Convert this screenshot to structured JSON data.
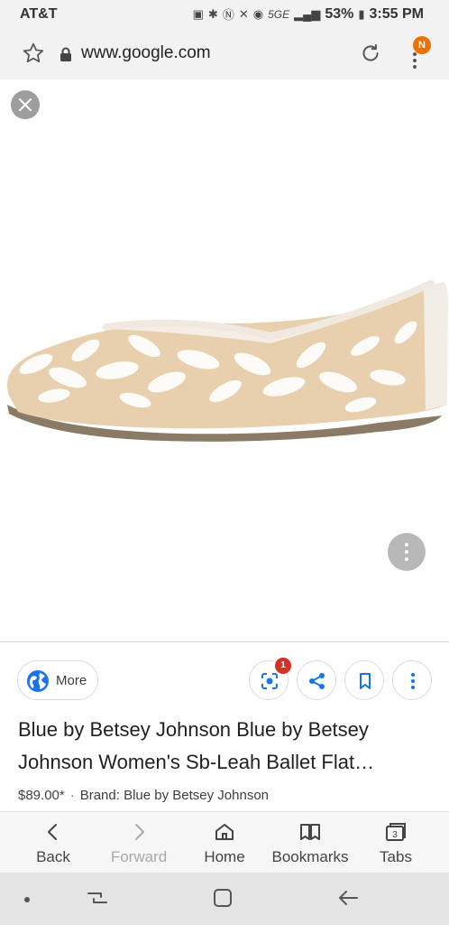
{
  "status_bar": {
    "carrier": "AT&T",
    "network": "5G",
    "network_sub": "E",
    "battery_percent": "53%",
    "time": "3:55 PM"
  },
  "browser": {
    "url": "www.google.com",
    "menu_badge": "N"
  },
  "viewer": {
    "image_alt": "Women's ballet flat with white embroidered leaves on nude mesh"
  },
  "actions": {
    "more_label": "More",
    "lens_badge": "1"
  },
  "result": {
    "title": "Blue by Betsey Johnson Blue by Betsey Johnson Women's Sb-Leah Ballet Flat…",
    "price": "$89.00*",
    "brand": "Brand: Blue by Betsey Johnson"
  },
  "bottom_nav": {
    "items": [
      {
        "label": "Back",
        "icon": "chevron-left-icon"
      },
      {
        "label": "Forward",
        "icon": "chevron-right-icon"
      },
      {
        "label": "Home",
        "icon": "home-icon"
      },
      {
        "label": "Bookmarks",
        "icon": "bookmarks-icon"
      },
      {
        "label": "Tabs",
        "icon": "tabs-icon",
        "count": "3"
      }
    ]
  },
  "colors": {
    "accent": "#1a73e8",
    "badge_orange": "#e8710a",
    "badge_red": "#d93025"
  }
}
